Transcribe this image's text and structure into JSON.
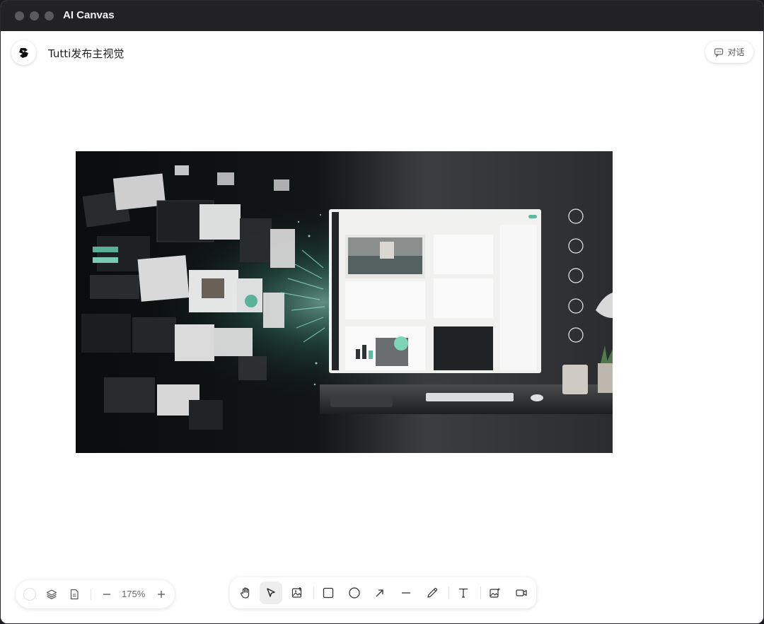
{
  "window": {
    "title": "AI Canvas"
  },
  "header": {
    "doc_title": "Tutti发布主视觉",
    "chat_label": "对话"
  },
  "zoom": {
    "level": "175%"
  },
  "toolbar": {
    "tools": [
      {
        "name": "hand",
        "icon": "hand-icon"
      },
      {
        "name": "select",
        "icon": "cursor-icon",
        "active": true
      },
      {
        "name": "upload-image",
        "icon": "image-upload-icon"
      },
      {
        "name": "rectangle",
        "icon": "rectangle-icon"
      },
      {
        "name": "ellipse",
        "icon": "circle-icon"
      },
      {
        "name": "arrow",
        "icon": "arrow-icon"
      },
      {
        "name": "line",
        "icon": "line-icon"
      },
      {
        "name": "pencil",
        "icon": "pencil-icon"
      },
      {
        "name": "text",
        "icon": "text-icon"
      },
      {
        "name": "ai-image",
        "icon": "ai-image-icon"
      },
      {
        "name": "video",
        "icon": "video-icon"
      }
    ]
  },
  "colors": {
    "titlebar": "#222224",
    "accent_teal": "#7fd4b8",
    "canvas_bg": "#ffffff"
  }
}
